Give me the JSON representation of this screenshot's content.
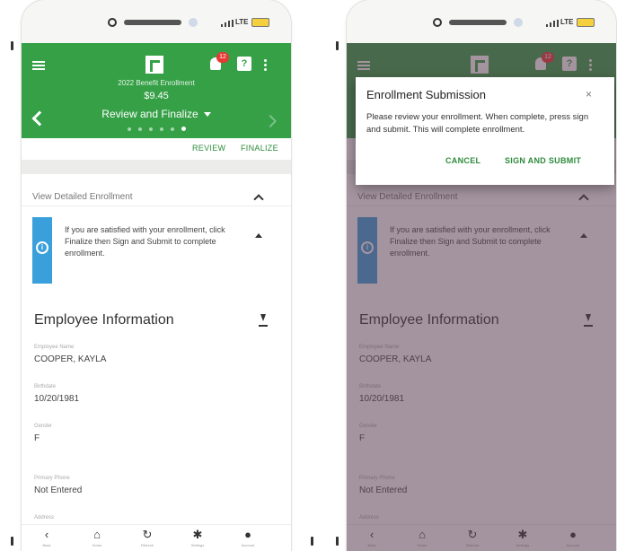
{
  "status": {
    "network": "LTE"
  },
  "header": {
    "notification_count": "12",
    "help_glyph": "?",
    "subtitle": "2022 Benefit Enrollment",
    "amount": "$9.45",
    "step": "Review and Finalize",
    "step_count": 6,
    "active_step": 6
  },
  "tabs": {
    "review": "REVIEW",
    "finalize": "FINALIZE"
  },
  "detail": {
    "label": "View Detailed Enrollment",
    "info_text": "If you are satisfied with your enrollment, click Finalize then Sign and Submit to complete enrollment."
  },
  "employee": {
    "title": "Employee Information",
    "fields": [
      {
        "label": "Employee Name",
        "value": "COOPER, KAYLA"
      },
      {
        "label": "Birthdate",
        "value": "10/20/1981"
      },
      {
        "label": "Gender",
        "value": "F"
      },
      {
        "label": "Primary Phone",
        "value": "Not Entered"
      },
      {
        "label": "Address",
        "value": ""
      }
    ]
  },
  "bottom_nav": [
    {
      "icon": "back-icon",
      "glyph": "‹",
      "label": "Back"
    },
    {
      "icon": "home-icon",
      "glyph": "⌂",
      "label": "Home"
    },
    {
      "icon": "refresh-icon",
      "glyph": "↻",
      "label": "Refresh"
    },
    {
      "icon": "gear-icon",
      "glyph": "✱",
      "label": "Settings"
    },
    {
      "icon": "account-icon",
      "glyph": "●",
      "label": "Account"
    }
  ],
  "dialog": {
    "title": "Enrollment Submission",
    "close_glyph": "×",
    "body": "Please review your enrollment. When complete, press sign and submit. This will complete enrollment.",
    "cancel": "CANCEL",
    "submit": "SIGN AND SUBMIT"
  },
  "colors": {
    "brand_green": "#36a047",
    "info_blue": "#3aa0dc",
    "badge_red": "#e53935"
  }
}
